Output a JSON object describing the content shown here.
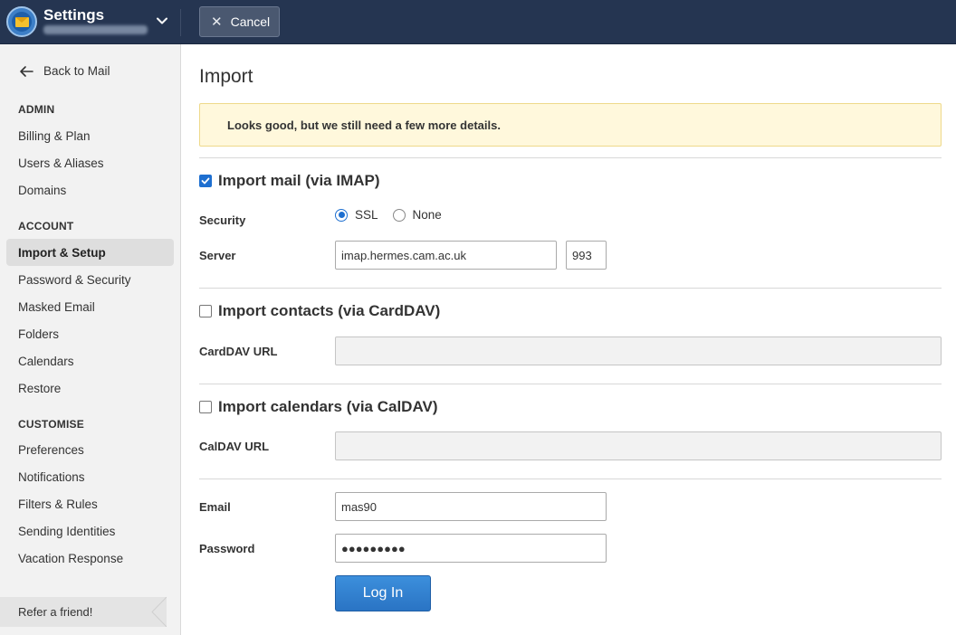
{
  "header": {
    "app_title": "Settings",
    "cancel_label": "Cancel"
  },
  "sidebar": {
    "back_label": "Back to Mail",
    "sections": [
      {
        "heading": "ADMIN",
        "items": [
          "Billing & Plan",
          "Users & Aliases",
          "Domains"
        ]
      },
      {
        "heading": "ACCOUNT",
        "items": [
          "Import & Setup",
          "Password & Security",
          "Masked Email",
          "Folders",
          "Calendars",
          "Restore"
        ]
      },
      {
        "heading": "CUSTOMISE",
        "items": [
          "Preferences",
          "Notifications",
          "Filters & Rules",
          "Sending Identities",
          "Vacation Response"
        ]
      }
    ],
    "active_item": "Import & Setup",
    "refer_label": "Refer a friend!"
  },
  "main": {
    "title": "Import",
    "notice": "Looks good, but we still need a few more details.",
    "imap": {
      "checkbox_label": "Import mail (via IMAP)",
      "checked": true,
      "security_label": "Security",
      "security_options": [
        "SSL",
        "None"
      ],
      "security_selected": "SSL",
      "server_label": "Server",
      "server_value": "imap.hermes.cam.ac.uk",
      "port_value": "993"
    },
    "carddav": {
      "checkbox_label": "Import contacts (via CardDAV)",
      "checked": false,
      "url_label": "CardDAV URL",
      "url_value": ""
    },
    "caldav": {
      "checkbox_label": "Import calendars (via CalDAV)",
      "checked": false,
      "url_label": "CalDAV URL",
      "url_value": ""
    },
    "credentials": {
      "email_label": "Email",
      "email_value": "mas90",
      "password_label": "Password",
      "password_value": "●●●●●●●●●"
    },
    "login_label": "Log In"
  },
  "colors": {
    "topbar": "#253551",
    "accent": "#1e6fd0",
    "notice_bg": "#fff8dc"
  }
}
